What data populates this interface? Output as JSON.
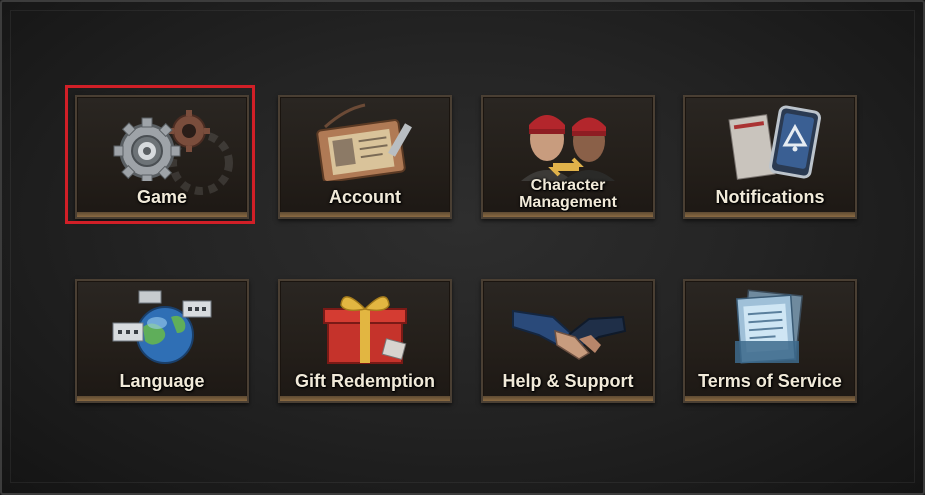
{
  "menu": {
    "items": [
      {
        "label": "Game",
        "icon": "gears-icon"
      },
      {
        "label": "Account",
        "icon": "id-card-icon"
      },
      {
        "label": "Character\nManagement",
        "icon": "character-swap-icon"
      },
      {
        "label": "Notifications",
        "icon": "phone-bell-icon"
      },
      {
        "label": "Language",
        "icon": "globe-chat-icon"
      },
      {
        "label": "Gift Redemption",
        "icon": "gift-box-icon"
      },
      {
        "label": "Help & Support",
        "icon": "handshake-icon"
      },
      {
        "label": "Terms of Service",
        "icon": "documents-icon"
      }
    ],
    "selected_index": 0
  },
  "colors": {
    "highlight": "#d11f27",
    "label": "#f1ead9",
    "tile_border": "#4a3f33"
  }
}
